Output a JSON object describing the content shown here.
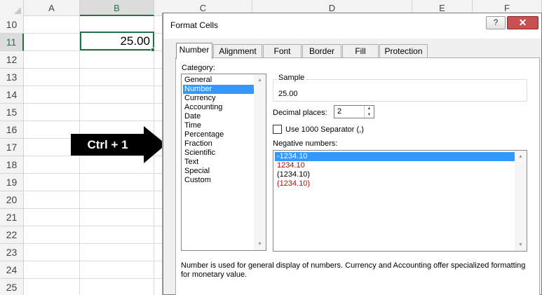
{
  "spreadsheet": {
    "columns": [
      "A",
      "B",
      "C",
      "D",
      "E",
      "F"
    ],
    "rows": [
      "10",
      "11",
      "12",
      "13",
      "14",
      "15",
      "16",
      "17",
      "18",
      "19",
      "20",
      "21",
      "22",
      "23",
      "24",
      "25"
    ],
    "selected_cell_value": "25.00"
  },
  "overlay": {
    "shortcut_label": "Ctrl + 1"
  },
  "dialog": {
    "title": "Format Cells",
    "help_label": "?",
    "close_label": "✕",
    "tabs": [
      {
        "label": "Number"
      },
      {
        "label": "Alignment"
      },
      {
        "label": "Font"
      },
      {
        "label": "Border"
      },
      {
        "label": "Fill"
      },
      {
        "label": "Protection"
      }
    ],
    "category_label": "Category:",
    "categories": [
      "General",
      "Number",
      "Currency",
      "Accounting",
      "Date",
      "Time",
      "Percentage",
      "Fraction",
      "Scientific",
      "Text",
      "Special",
      "Custom"
    ],
    "sample_label": "Sample",
    "sample_value": "25.00",
    "decimal_places_label": "Decimal places:",
    "decimal_places_value": "2",
    "use_separator_label": "Use 1000 Separator (,)",
    "negative_numbers_label": "Negative numbers:",
    "negative_numbers": [
      {
        "text": "-1234.10"
      },
      {
        "text": "1234.10"
      },
      {
        "text": "(1234.10)"
      },
      {
        "text": "(1234.10)"
      }
    ],
    "description": "Number is used for general display of numbers.  Currency and Accounting offer specialized formatting for monetary value."
  }
}
